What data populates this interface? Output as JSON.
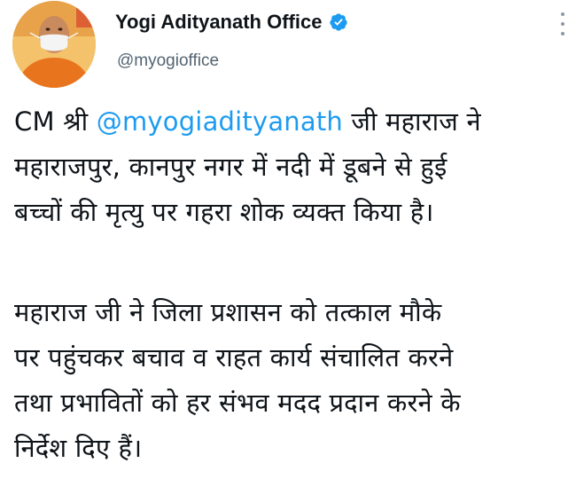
{
  "author": {
    "display_name": "Yogi Adityanath Office",
    "handle": "@myogioffice",
    "verified": true,
    "avatar_icon": "profile-photo-icon"
  },
  "menu": {
    "icon": "more-vertical-icon"
  },
  "tweet": {
    "paragraph1": {
      "line1_prefix": "CM श्री ",
      "line1_mention": "@myogiadityanath",
      "line1_suffix": " जी महाराज ने",
      "line2": "महाराजपुर, कानपुर नगर में नदी में डूबने से हुई",
      "line3": "बच्चों की मृत्यु पर गहरा शोक व्यक्त किया है।"
    },
    "paragraph2": {
      "line1": "महाराज जी ने जिला प्रशासन को तत्काल मौके",
      "line2": "पर पहुंचकर बचाव व राहत कार्य संचालित करने",
      "line3": "तथा प्रभावितों को हर संभव मदद प्रदान करने के",
      "line4": "निर्देश दिए हैं।"
    }
  },
  "colors": {
    "link": "#1d9bf0",
    "text": "#0f1419",
    "secondary": "#536471",
    "verified": "#1d9bf0"
  }
}
